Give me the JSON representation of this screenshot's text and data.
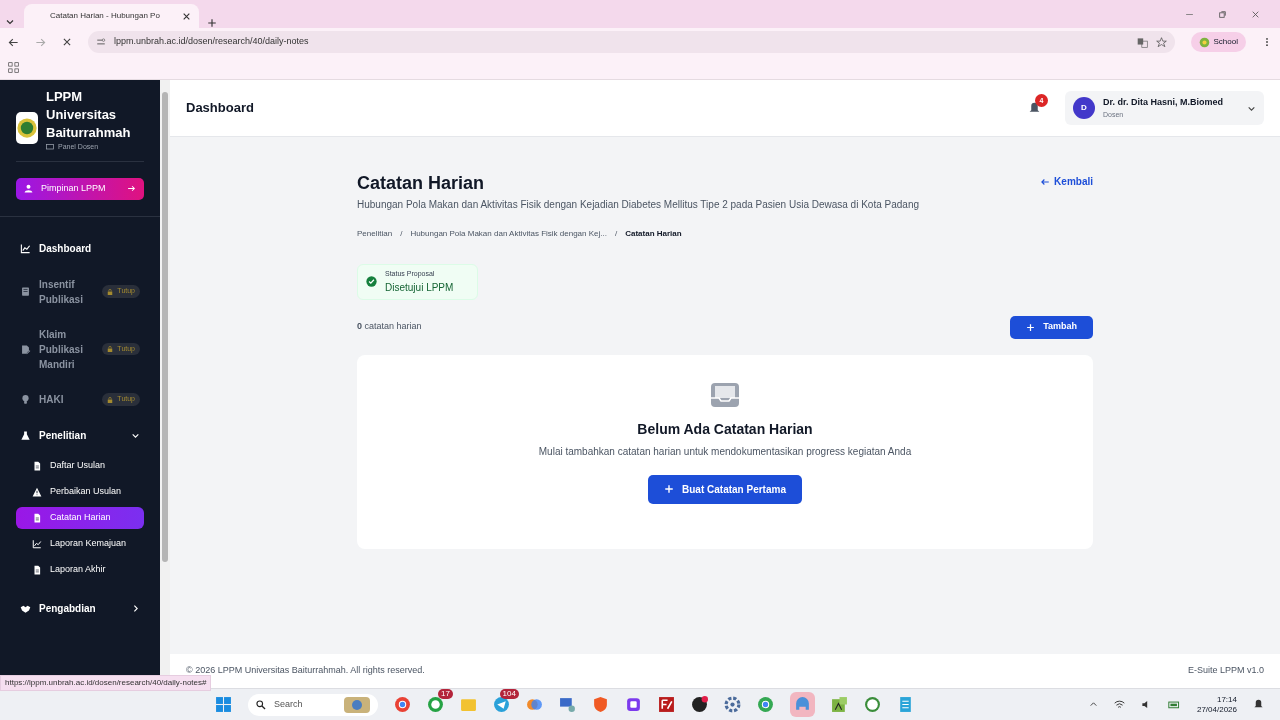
{
  "browser": {
    "tab_title": "Catatan Harian - Hubungan Po",
    "url": "lppm.unbrah.ac.id/dosen/research/40/daily-notes",
    "profile": "School",
    "status_url": "https://lppm.unbrah.ac.id/dosen/research/40/daily-notes#"
  },
  "sidebar": {
    "brand": "LPPM Universitas Baiturrahmah",
    "panel": "Panel Dosen",
    "role_button": "Pimpinan LPPM",
    "items": [
      {
        "label": "Dashboard",
        "kind": "link",
        "locked": false
      },
      {
        "label": "Insentif Publikasi",
        "kind": "link",
        "locked": true,
        "badge": "Tutup"
      },
      {
        "label": "Klaim Publikasi Mandiri",
        "kind": "link",
        "locked": true,
        "badge": "Tutup"
      },
      {
        "label": "HAKI",
        "kind": "link",
        "locked": true,
        "badge": "Tutup"
      },
      {
        "label": "Penelitian",
        "kind": "group",
        "expanded": true,
        "children": [
          {
            "label": "Daftar Usulan",
            "selected": false
          },
          {
            "label": "Perbaikan Usulan",
            "selected": false
          },
          {
            "label": "Catatan Harian",
            "selected": true
          },
          {
            "label": "Laporan Kemajuan",
            "selected": false
          },
          {
            "label": "Laporan Akhir",
            "selected": false
          }
        ]
      },
      {
        "label": "Pengabdian",
        "kind": "group",
        "expanded": false
      }
    ]
  },
  "header": {
    "title": "Dashboard",
    "notifications": "4",
    "user_initial": "D",
    "user_name": "Dr. dr. Dita Hasni, M.Biomed",
    "user_role": "Dosen"
  },
  "page": {
    "title": "Catatan Harian",
    "subtitle": "Hubungan Pola Makan dan Aktivitas Fisik dengan Kejadian Diabetes Mellitus Tipe 2 pada Pasien Usia Dewasa di Kota Padang",
    "back": "Kembali",
    "breadcrumbs": [
      {
        "label": "Penelitian",
        "current": false
      },
      {
        "separator": "/",
        "label": "Hubungan Pola Makan dan Aktivitas Fisik dengan Kej...",
        "current": false
      },
      {
        "separator": "/",
        "label": "Catatan Harian",
        "current": true
      }
    ],
    "status": {
      "label": "Status Proposal",
      "value": "Disetujui LPPM"
    },
    "count": "**0** catatan harian",
    "add_button": "Tambah",
    "empty": {
      "title": "Belum Ada Catatan Harian",
      "text": "Mulai tambahkan catatan harian untuk mendokumentasikan progress kegiatan Anda",
      "button": "Buat Catatan Pertama"
    }
  },
  "footer": {
    "copyright": "© 2026 LPPM Universitas Baiturrahmah. All rights reserved.",
    "version": "E-Suite LPPM v1.0"
  },
  "taskbar": {
    "search": "Search",
    "chat_badge": "17",
    "mail_badge": "104",
    "time": "17:14",
    "date": "27/04/2026"
  }
}
